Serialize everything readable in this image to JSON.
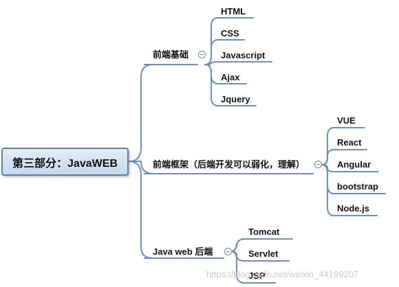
{
  "root": {
    "label": "第三部分：JavaWEB"
  },
  "branches": [
    {
      "label": "前端基础",
      "children": [
        "HTML",
        "CSS",
        "Javascript",
        "Ajax",
        "Jquery"
      ]
    },
    {
      "label": "前端框架（后端开发可以弱化，理解）",
      "children": [
        "VUE",
        "React",
        "Angular",
        "bootstrap",
        "Node.js"
      ]
    },
    {
      "label": "Java web 后端",
      "children": [
        "Tomcat",
        "Servlet",
        "JSP"
      ]
    }
  ],
  "watermark": "https://blog.csdn.net/weixin_44199207",
  "colors": {
    "line": "#6a8fb8",
    "root_border": "#5b7fa6"
  }
}
